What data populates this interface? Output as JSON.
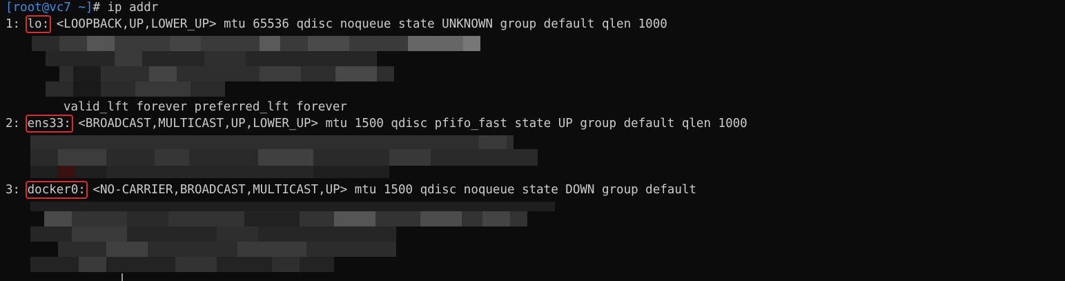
{
  "terminal": {
    "prompt": {
      "user_host": "[root@vc7 ~]",
      "symbol": "#",
      "command": " ip addr"
    },
    "interfaces": [
      {
        "index": "1:",
        "name": "lo:",
        "flags": " <LOOPBACK,UP,LOWER_UP> mtu 65536 qdisc noqueue state UNKNOWN group default qlen 1000",
        "valid_lft": "valid_lft forever preferred_lft forever"
      },
      {
        "index": "2:",
        "name": "ens33:",
        "flags": " <BROADCAST,MULTICAST,UP,LOWER_UP> mtu 1500 qdisc pfifo_fast state UP group default qlen 1000"
      },
      {
        "index": "3:",
        "name": "docker0:",
        "flags": " <NO-CARRIER,BROADCAST,MULTICAST,UP> mtu 1500 qdisc noqueue state DOWN group default"
      }
    ],
    "colors": {
      "background": "#0c0c0c",
      "text": "#cccccc",
      "prompt_user": "#3b8eea",
      "highlight_box": "#e32b2b"
    }
  }
}
